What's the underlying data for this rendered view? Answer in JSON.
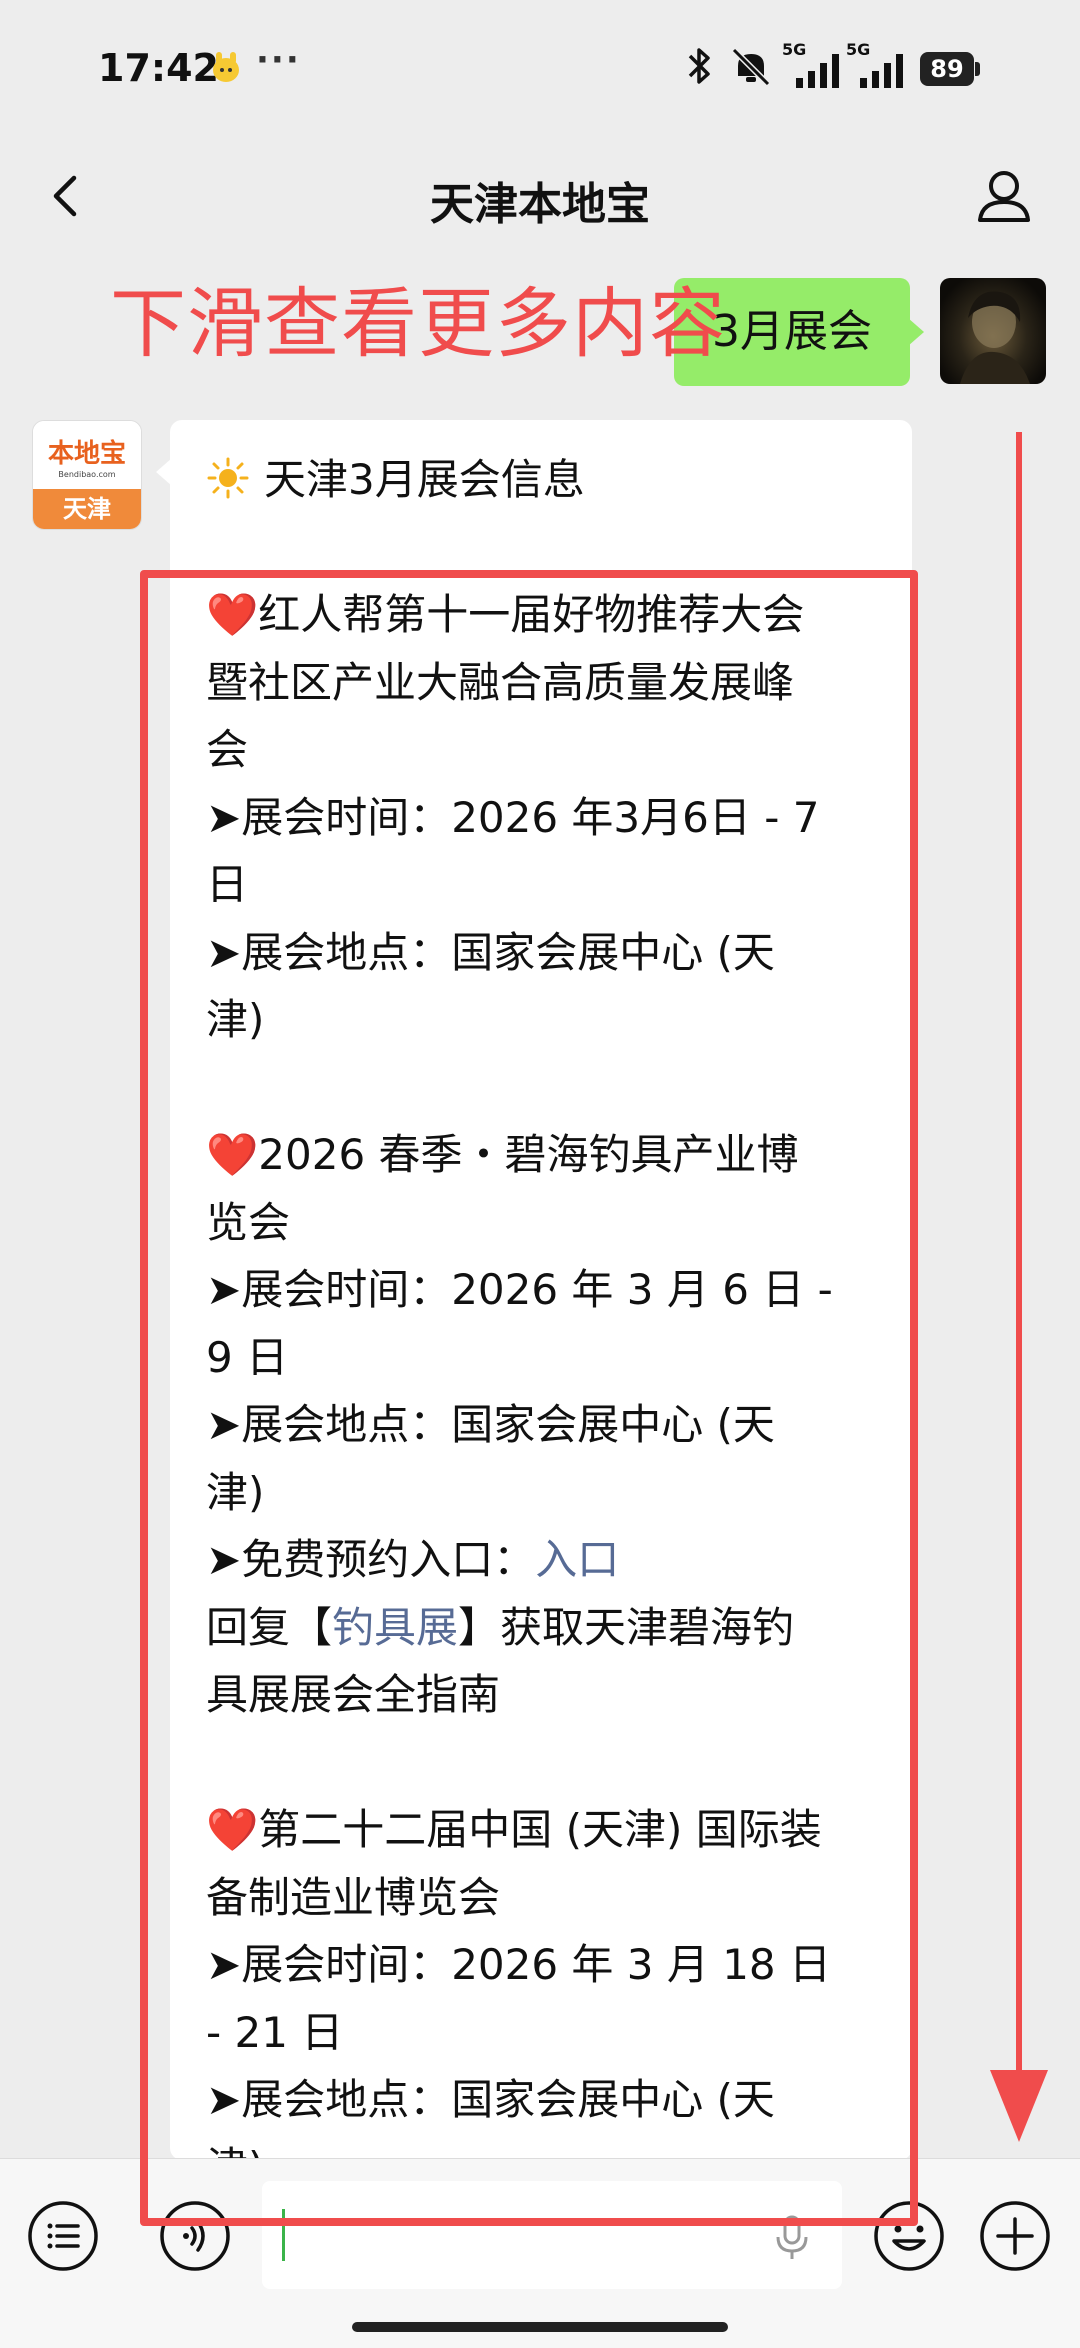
{
  "status_bar": {
    "time": "17:42",
    "dots": "···",
    "net1": "5G",
    "net2": "5G",
    "battery": "89"
  },
  "nav": {
    "title": "天津本地宝",
    "back_icon": "chevron-left-icon",
    "profile_icon": "person-icon"
  },
  "overlay_hint": "下滑查看更多内容",
  "sent_message": "3月展会",
  "bot_avatar": {
    "logo_text": "本地宝",
    "url_text": "Bendibao.com",
    "city": "天津"
  },
  "message": {
    "title": "天津3月展会信息",
    "lines": [
      {
        "t": "title"
      },
      {
        "t": "blank"
      },
      {
        "t": "text",
        "s": "❤️红人帮第十一届好物推荐大会"
      },
      {
        "t": "text",
        "s": "暨社区产业大融合高质量发展峰"
      },
      {
        "t": "text",
        "s": "会"
      },
      {
        "t": "text",
        "s": "➤展会时间：2026 年3月6日 - 7"
      },
      {
        "t": "text",
        "s": "日"
      },
      {
        "t": "text",
        "s": "➤展会地点：国家会展中心 (天"
      },
      {
        "t": "text",
        "s": "津)"
      },
      {
        "t": "blank"
      },
      {
        "t": "text",
        "s": "❤️2026 春季・碧海钓具产业博"
      },
      {
        "t": "text",
        "s": "览会"
      },
      {
        "t": "text",
        "s": "➤展会时间：2026 年 3 月 6 日 -"
      },
      {
        "t": "text",
        "s": "9 日"
      },
      {
        "t": "text",
        "s": "➤展会地点：国家会展中心 (天"
      },
      {
        "t": "text",
        "s": "津)"
      },
      {
        "t": "link1"
      },
      {
        "t": "link2"
      },
      {
        "t": "text",
        "s": "具展展会全指南"
      },
      {
        "t": "blank"
      },
      {
        "t": "text",
        "s": "❤️第二十二届中国 (天津) 国际装"
      },
      {
        "t": "text",
        "s": "备制造业博览会"
      },
      {
        "t": "text",
        "s": "➤展会时间：2026 年 3 月 18 日"
      },
      {
        "t": "text",
        "s": "- 21 日"
      },
      {
        "t": "text",
        "s": "➤展会地点：国家会展中心 (天"
      },
      {
        "t": "text",
        "s": "津)"
      }
    ],
    "reserve_label": "➤免费预约入口：",
    "reserve_link": "入口",
    "reply_prefix": "回复【",
    "reply_keyword": "钓具展",
    "reply_suffix": "】获取天津碧海钓"
  },
  "input_bar": {
    "menu_icon": "menu-list-icon",
    "voice_icon": "voice-icon",
    "mic_icon": "microphone-icon",
    "emoji_icon": "emoji-icon",
    "plus_icon": "plus-icon",
    "placeholder": ""
  },
  "colors": {
    "annotation_red": "#f04c4c",
    "sent_bubble": "#95ec69",
    "link": "#576b95",
    "avatar_orange": "#f08a3a"
  }
}
